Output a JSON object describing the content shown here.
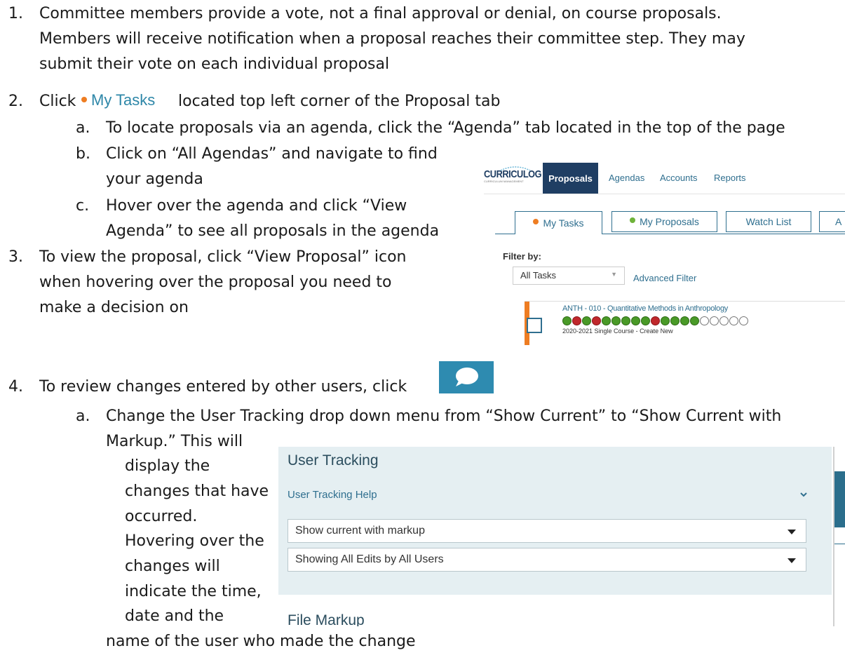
{
  "steps": {
    "s1": {
      "num": "1.",
      "line1": "Committee members provide a vote, not a final approval or denial, on course proposals.",
      "line2": "Members will receive notification when a proposal reaches their committee step. They may",
      "line3": "submit their vote on each individual proposal"
    },
    "s2": {
      "num": "2.",
      "click": "Click",
      "icon_label": "My Tasks",
      "after": "located top left corner of the Proposal tab",
      "a_letter": "a.",
      "a_text": "To locate proposals via an agenda, click the “Agenda” tab located in the top of the page",
      "b_letter": "b.",
      "b_line1": "Click on “All Agendas” and navigate to find",
      "b_line2": "your agenda",
      "c_letter": "c.",
      "c_line1": "Hover over the agenda and click “View",
      "c_line2": "Agenda” to see all proposals in the agenda"
    },
    "s3": {
      "num": "3.",
      "line1": "To view the proposal, click “View Proposal” icon",
      "line2": "when hovering over the proposal you need to",
      "line3": "make a decision on"
    },
    "s4": {
      "num": "4.",
      "text": "To review changes entered by other users, click",
      "a_letter": "a.",
      "a_line1": "Change the User Tracking drop down menu from “Show Current” to “Show Current with",
      "a_lines": [
        "Markup.” This will",
        "display the",
        "changes that have",
        "occurred.",
        "Hovering over the",
        "changes will",
        "indicate the time,",
        "date and the"
      ],
      "a_last": "name of the user who made the change"
    }
  },
  "curriculog": {
    "logo": "CURRICULOG",
    "logo_sub": "CURRICULUM MANAGEMENT",
    "nav": [
      "Proposals",
      "Agendas",
      "Accounts",
      "Reports"
    ],
    "tabs": [
      "My Tasks",
      "My Proposals",
      "Watch List",
      "A"
    ],
    "filter_label": "Filter by:",
    "filter_value": "All Tasks",
    "advanced_filter": "Advanced Filter",
    "proposal_title": "ANTH - 010 - Quantitative Methods in Anthropology",
    "proposal_sub": "2020-2021 Single Course - Create New",
    "votes": [
      "up",
      "down",
      "up",
      "down",
      "up",
      "up",
      "up",
      "up",
      "up",
      "down",
      "up",
      "up",
      "up",
      "up",
      "empty",
      "empty",
      "empty",
      "empty",
      "empty"
    ],
    "colors": {
      "nav_active": "#1f3e63",
      "accent_orange": "#ee7d22",
      "tab_border": "#2f6f8f",
      "link_blue": "#2f6f8f"
    }
  },
  "user_tracking": {
    "title": "User Tracking",
    "help": "User Tracking Help",
    "select1": "Show current with markup",
    "select2": "Showing All Edits by All Users",
    "file_markup": "File Markup",
    "colors": {
      "panel_bg": "#e5eff2",
      "title": "#2b4d5e",
      "help": "#2f6f8f"
    }
  },
  "comment_icon": "comment-bubble-icon"
}
